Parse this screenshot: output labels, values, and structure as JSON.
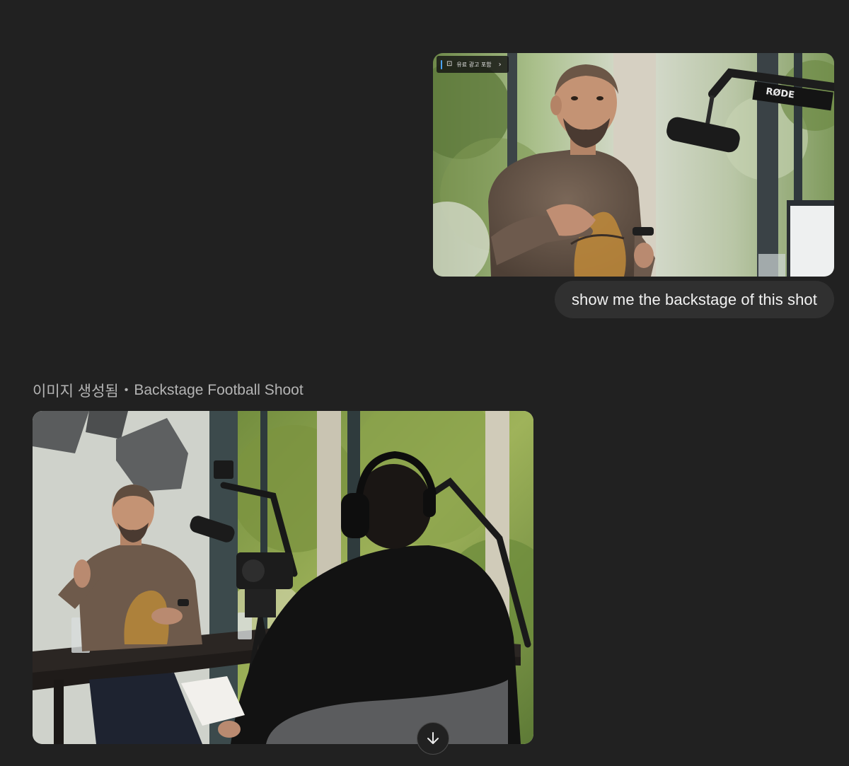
{
  "user_message": {
    "image_badge": {
      "text": "유료 광고 포함",
      "icon": "camera-icon",
      "chevron": "›"
    },
    "image_watermark": "RØDE",
    "text": "show me the backstage of this shot"
  },
  "assistant_message": {
    "status": "이미지 생성됨",
    "separator": "•",
    "title": "Backstage Football Shoot"
  },
  "scroll_button": {
    "icon": "arrow-down-icon"
  },
  "colors": {
    "background": "#212121",
    "bubble": "#303030",
    "badge_accent": "#4aa3ff"
  }
}
